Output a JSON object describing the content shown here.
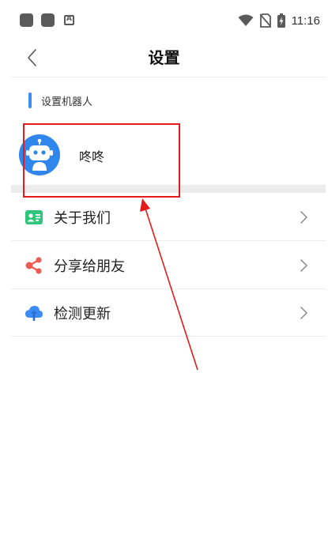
{
  "status_bar": {
    "time": "11:16",
    "icons": [
      "app-square-icon",
      "app-square-icon",
      "a-notification-icon",
      "wifi-icon",
      "no-sim-icon",
      "battery-charging-icon"
    ]
  },
  "header": {
    "title": "设置",
    "back_icon": "chevron-left-icon"
  },
  "section": {
    "title": "设置机器人",
    "bot": {
      "name": "咚咚",
      "avatar_icon": "robot-avatar-icon"
    }
  },
  "menu": [
    {
      "label": "关于我们",
      "icon": "about-card-icon",
      "color": "#2fc57c"
    },
    {
      "label": "分享给朋友",
      "icon": "share-icon",
      "color": "#ef5b55"
    },
    {
      "label": "检测更新",
      "icon": "cloud-upload-icon",
      "color": "#3b8cf6"
    }
  ],
  "colors": {
    "accent": "#3b8cf6",
    "annotation": "#e51b1b",
    "divider": "#ececec"
  }
}
